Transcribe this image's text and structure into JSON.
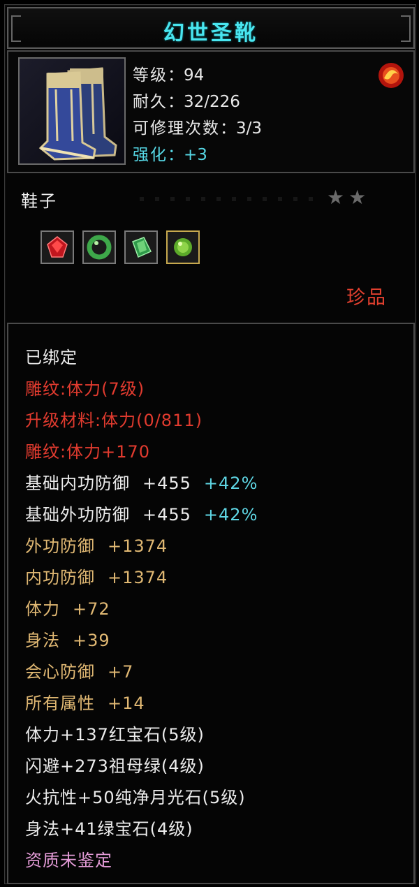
{
  "title": "幻世圣靴",
  "item": {
    "image": "blue-boots-icon",
    "stats": [
      {
        "label": "等级",
        "value": "94"
      },
      {
        "label": "耐久",
        "value": "32/226"
      },
      {
        "label": "可修理次数",
        "value": "3/3"
      },
      {
        "label": "强化",
        "value": "+3"
      }
    ],
    "separator": "：",
    "badge_icon": "fire-orb-icon"
  },
  "type": {
    "label": "鞋子",
    "stars": "★★"
  },
  "gems": [
    "red-gem-icon",
    "green-ring-icon",
    "emerald-icon",
    "green-orb-icon"
  ],
  "rarity": "珍品",
  "attributes": {
    "bound": "已绑定",
    "engrave1": "雕纹:体力(7级)",
    "upgrade": "升级材料:体力(0/811)",
    "engrave2": "雕纹:体力+170",
    "base_inner": {
      "label": "基础内功防御",
      "value": "+455",
      "pct": "+42%"
    },
    "base_outer": {
      "label": "基础外功防御",
      "value": "+455",
      "pct": "+42%"
    },
    "outer_def": {
      "label": "外功防御",
      "value": "+1374"
    },
    "inner_def": {
      "label": "内功防御",
      "value": "+1374"
    },
    "stamina": {
      "label": "体力",
      "value": "+72"
    },
    "agility": {
      "label": "身法",
      "value": "+39"
    },
    "crit_def": {
      "label": "会心防御",
      "value": "+7"
    },
    "all_attr": {
      "label": "所有属性",
      "value": "+14"
    },
    "gem1": "体力+137红宝石(5级)",
    "gem2": "闪避+273祖母绿(4级)",
    "gem3": "火抗性+50纯净月光石(5级)",
    "gem4": "身法+41绿宝石(4级)",
    "quality": "资质未鉴定"
  },
  "colors": {
    "title": "#49e6f0",
    "red": "#e23b2f",
    "gold": "#e0b873",
    "cyan": "#5fd7e5",
    "pink": "#e59cd8"
  }
}
